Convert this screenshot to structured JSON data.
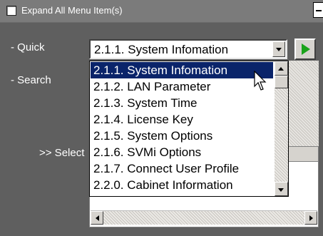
{
  "header": {
    "expand_label": "Expand All Menu Item(s)"
  },
  "labels": {
    "quick": "- Quick",
    "search": "- Search",
    "select": ">> Select"
  },
  "quick_combo": {
    "value": "2.1.1. System Infomation"
  },
  "dropdown": {
    "items": [
      "2.1.1. System Infomation",
      "2.1.2. LAN Parameter",
      "2.1.3. System Time",
      "2.1.4. License Key",
      "2.1.5. System Options",
      "2.1.6. SVMi Options",
      "2.1.7. Connect User Profile",
      "2.2.0. Cabinet Information"
    ],
    "selected_index": 0
  },
  "icons": {
    "go": "play-arrow-icon",
    "search": "magnifier-icon",
    "cursor": "mouse-pointer-icon"
  },
  "colors": {
    "background": "#5f5f5f",
    "header": "#7b7b7b",
    "selection": "#0a246a",
    "go_arrow": "#1aa31a",
    "magnifier": "#2c6fb8"
  }
}
